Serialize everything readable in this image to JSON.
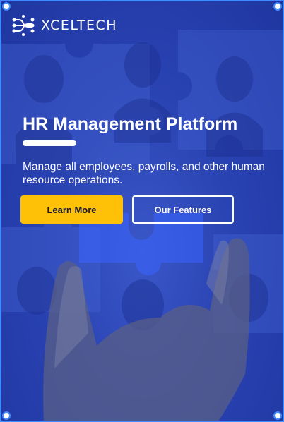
{
  "brand": {
    "name": "XCELTECH",
    "logo_icon": "circuit-icon"
  },
  "hero": {
    "title": "HR Management Platform",
    "description": "Manage all employees, payrolls, and other human resource operations.",
    "primary_button": "Learn More",
    "secondary_button": "Our Features"
  },
  "colors": {
    "background": "#2a43b3",
    "accent": "#ffc107",
    "text": "#ffffff",
    "selection_border": "#3f8bff"
  }
}
